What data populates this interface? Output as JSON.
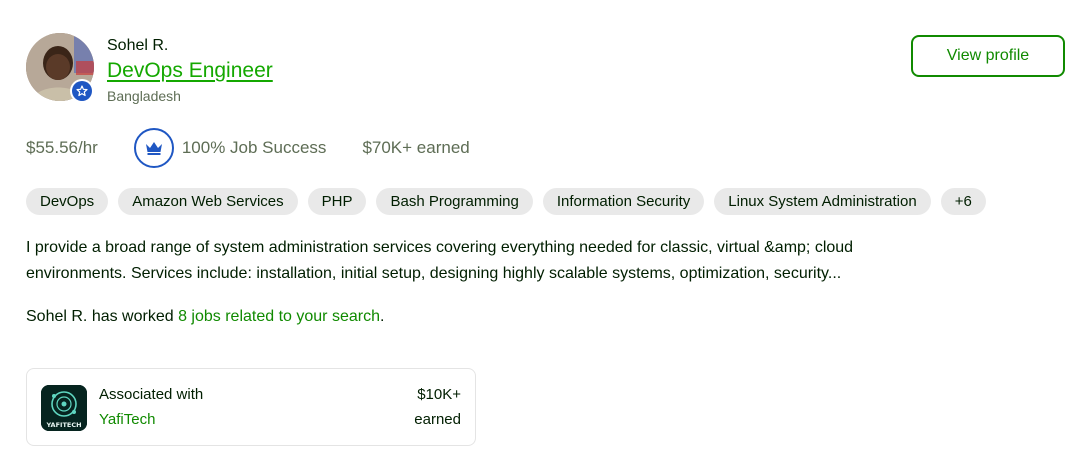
{
  "freelancer": {
    "name": "Sohel R.",
    "title": "DevOps Engineer",
    "location": "Bangladesh"
  },
  "actions": {
    "view_profile_label": "View profile"
  },
  "stats": {
    "rate": "$55.56/hr",
    "job_success": "100% Job Success",
    "earned": "$70K+ earned"
  },
  "skills": [
    "DevOps",
    "Amazon Web Services",
    "PHP",
    "Bash Programming",
    "Information Security",
    "Linux System Administration",
    "+6"
  ],
  "description": {
    "line1": "I provide a broad range of system administration services covering everything needed for classic, virtual &amp; cloud",
    "line2": "environments. Services include: installation, initial setup, designing highly scalable systems, optimization, security..."
  },
  "jobs": {
    "prefix": "Sohel R. has worked ",
    "link": "8 jobs related to your search",
    "suffix": "."
  },
  "agency": {
    "label": "Associated with",
    "name": "YafiTech",
    "amount": "$10K+",
    "earned_label": "earned",
    "logo_text": "YAFITECH"
  },
  "colors": {
    "brand_green": "#14a800",
    "link_green": "#108a00",
    "badge_blue": "#1f57c3",
    "muted": "#5e6d55",
    "chip_bg": "#e9e9e9"
  }
}
